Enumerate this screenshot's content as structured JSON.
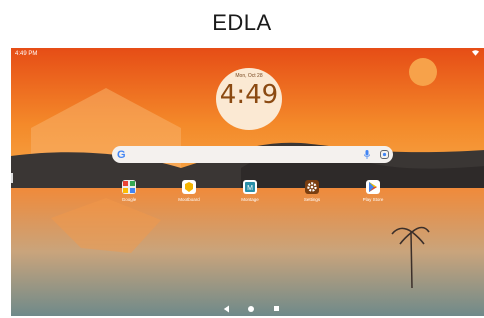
{
  "caption": "EDLA",
  "status_bar": {
    "time": "4:49 PM"
  },
  "clock": {
    "date": "Mon, Oct 28",
    "time": "4:49"
  },
  "search": {
    "google_letter": "G"
  },
  "apps": [
    {
      "label": "Google",
      "icon": "google-folder-icon"
    },
    {
      "label": "Mootboard",
      "icon": "mootboard-icon"
    },
    {
      "label": "Montage",
      "icon": "montage-icon"
    },
    {
      "label": "Settings",
      "icon": "settings-gear-icon"
    },
    {
      "label": "Play Store",
      "icon": "play-store-icon"
    }
  ],
  "colors": {
    "sky_top": "#e8571c",
    "sky_bottom": "#f7a33f",
    "dune_dark": "#3a3634",
    "clock_bg": "#fbe9d3"
  }
}
